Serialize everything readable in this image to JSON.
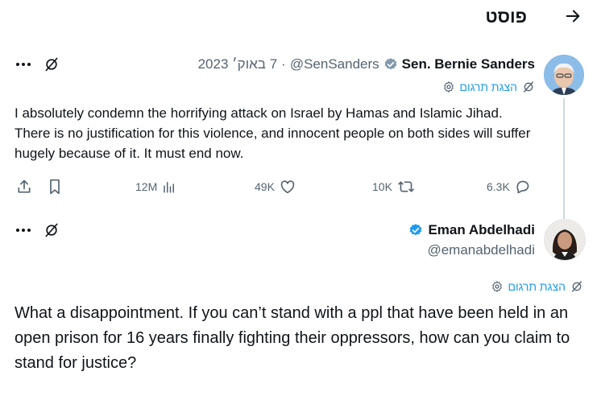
{
  "header": {
    "title": "פוסט"
  },
  "tweet": {
    "author_name": "Sen. Bernie Sanders",
    "handle": "@SenSanders",
    "date": "7 באוק׳ 2023",
    "translate_label": "הצגת תרגום",
    "text": "I absolutely condemn the horrifying attack on Israel by Hamas and Islamic Jihad. There is no justification for this violence, and innocent people on both sides will suffer hugely because of it. It must end now.",
    "metrics": {
      "views": "12M",
      "likes": "49K",
      "retweets": "10K",
      "replies": "6.3K"
    }
  },
  "reply": {
    "author_name": "Eman Abdelhadi",
    "handle": "@emanabdelhadi",
    "translate_label": "הצגת תרגום",
    "text": "What a disappointment. If you can’t stand with a ppl that have been held in an open prison for 16 years finally fighting their oppressors, how can you claim to stand for justice?"
  },
  "colors": {
    "accent": "#1d9bf0",
    "muted": "#536471",
    "verified_blue": "#1d9bf0",
    "verified_gray": "#829aab"
  },
  "icons": [
    "back-arrow-icon",
    "more-icon",
    "grok-icon",
    "verified-icon",
    "gear-icon",
    "share-icon",
    "bookmark-icon",
    "views-icon",
    "like-icon",
    "retweet-icon",
    "reply-icon"
  ]
}
